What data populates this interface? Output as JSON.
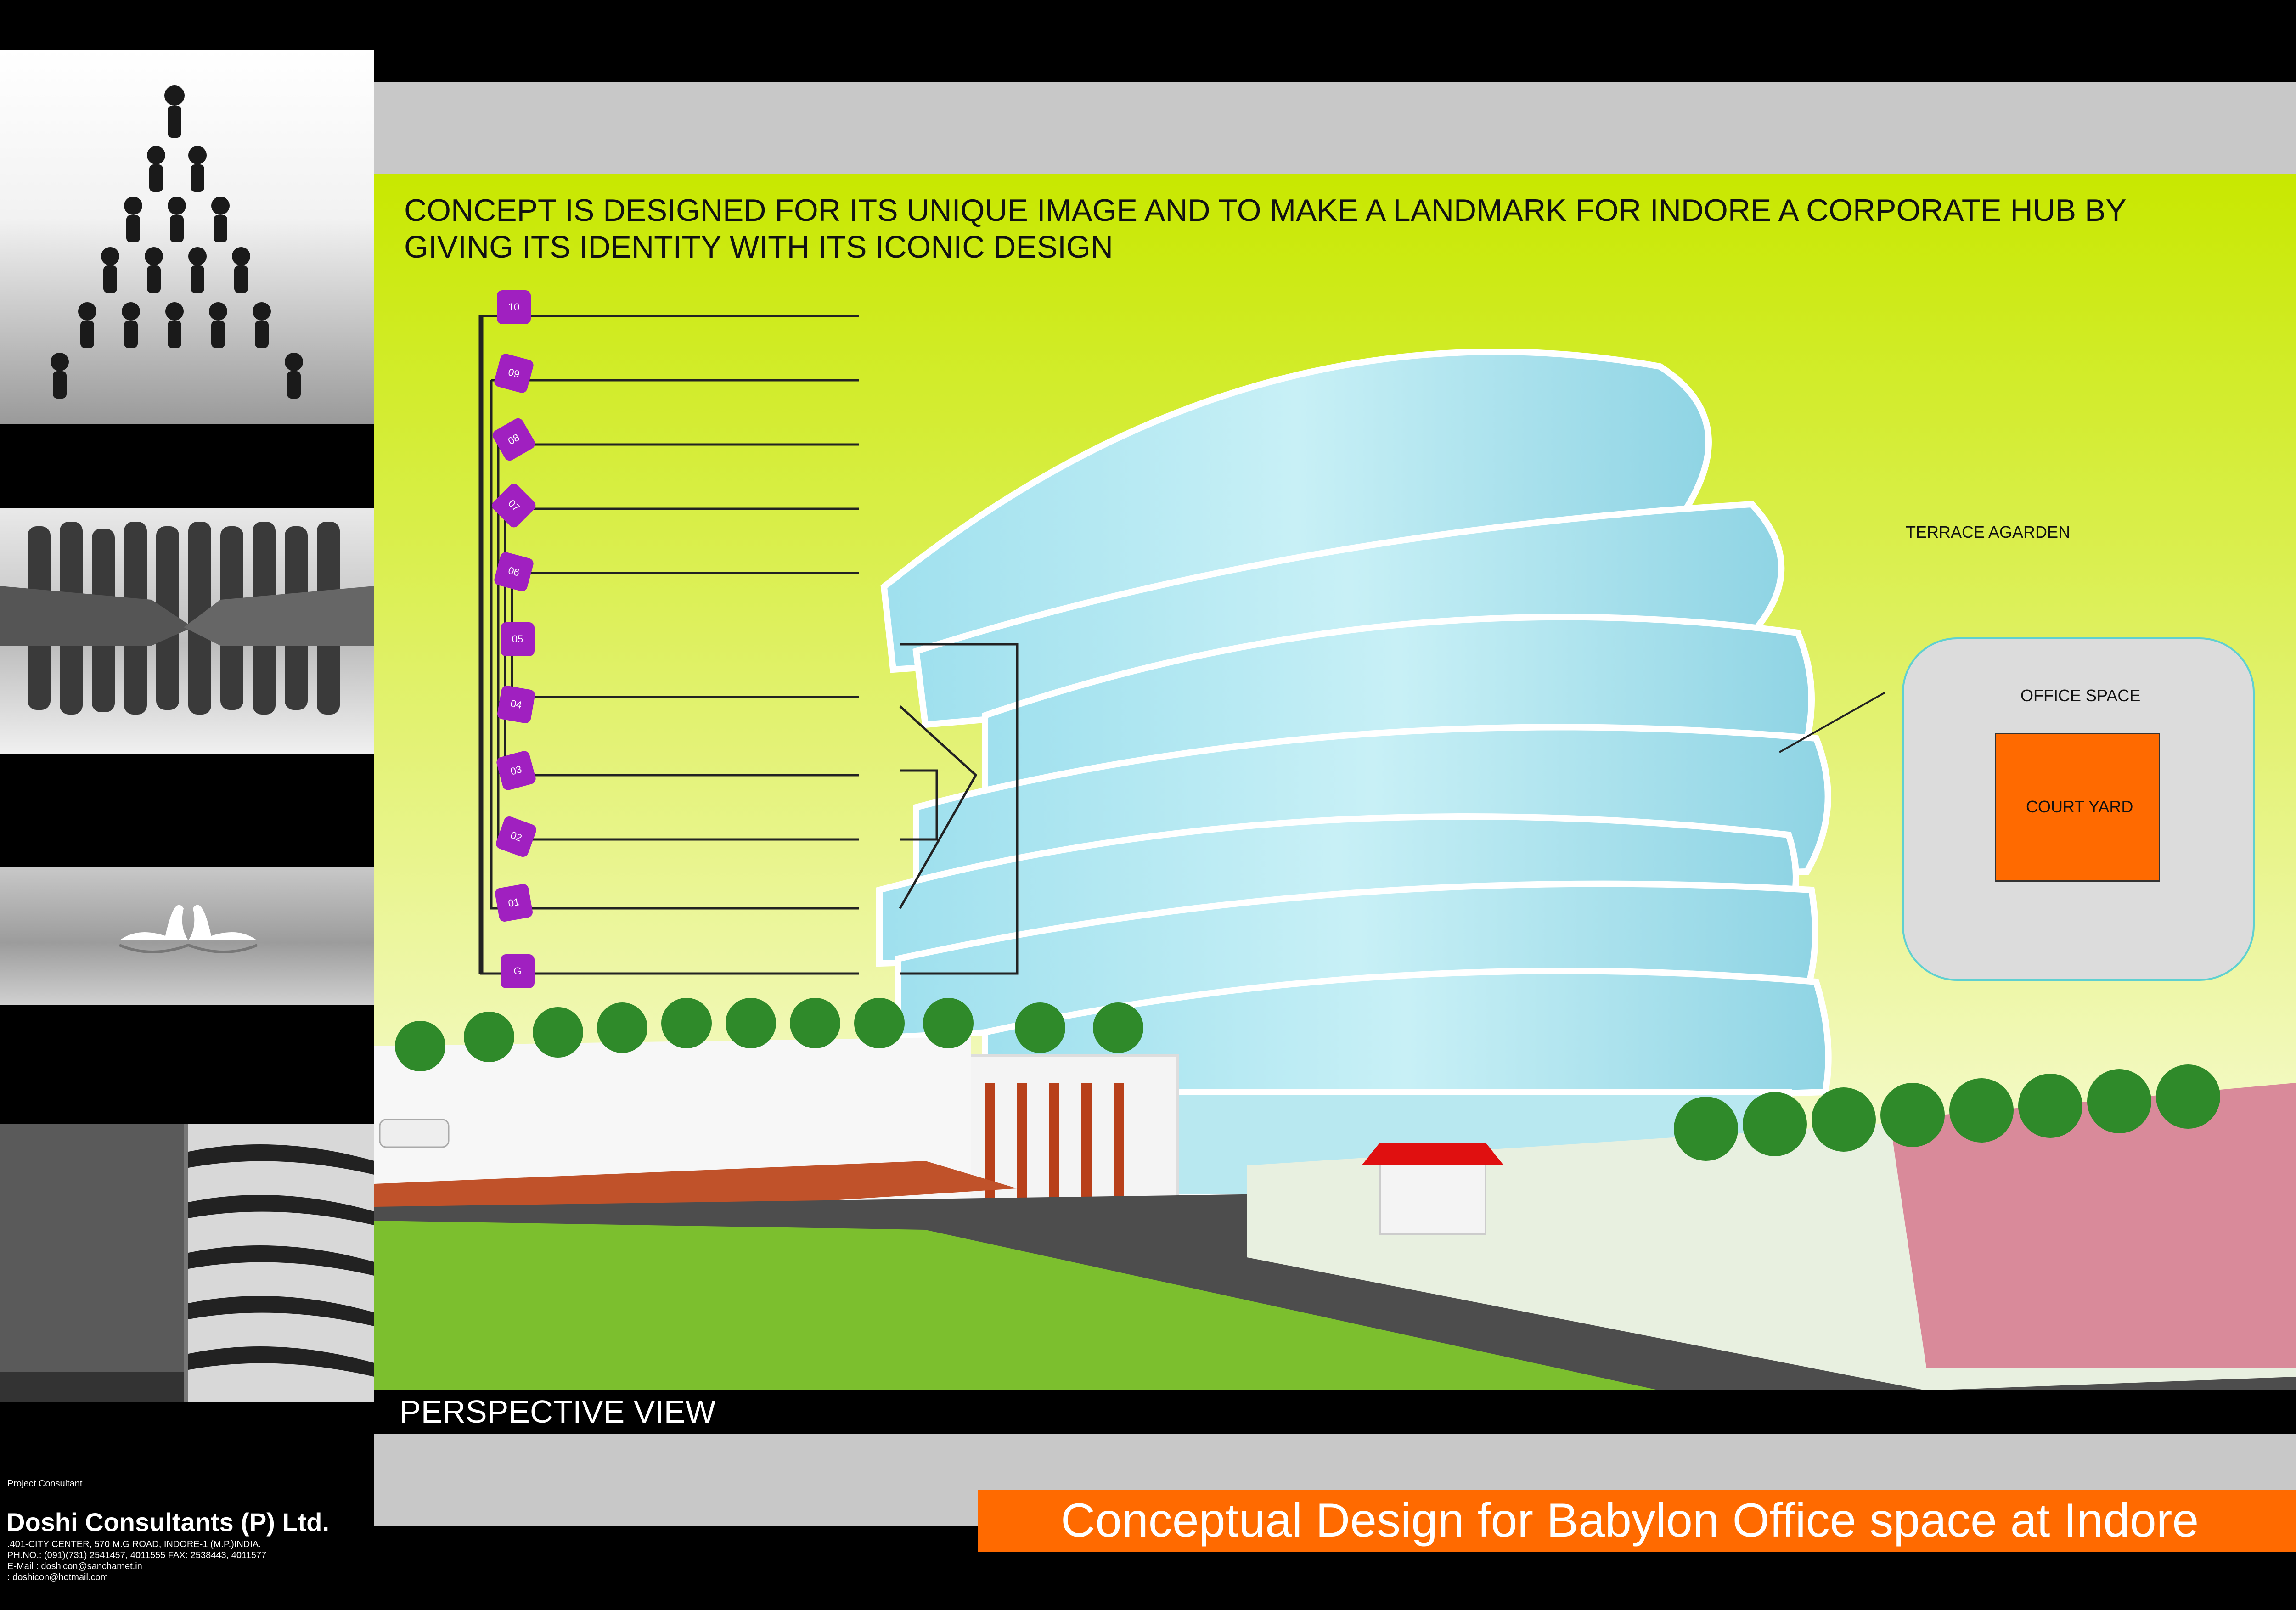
{
  "concept_text": "CONCEPT IS DESIGNED FOR ITS UNIQUE IMAGE AND TO MAKE A LANDMARK FOR INDORE A CORPORATE HUB  BY  GIVING ITS IDENTITY WITH ITS ICONIC DESIGN",
  "floors": [
    "10",
    "09",
    "08",
    "07",
    "06",
    "05",
    "04",
    "03",
    "02",
    "01",
    "G"
  ],
  "terrace_label": "TERRACE AGARDEN",
  "office_space_label": "OFFICE SPACE",
  "court_yard_label": "COURT YARD",
  "view_label": "PERSPECTIVE VIEW",
  "title": "Conceptual Design for Babylon Office space at Indore",
  "consultant": {
    "label": "Project Consultant",
    "name": "Doshi Consultants (P) Ltd.",
    "address_lines": [
      ".401-CITY CENTER, 570 M.G ROAD, INDORE-1 (M.P.)INDIA.",
      "PH.NO.: (091)(731) 2541457, 4011555 FAX: 2538443, 4011577",
      "E-Mail : doshicon@sancharnet.in",
      " : doshicon@hotmail.com"
    ]
  },
  "colors": {
    "accent_orange": "#ff6a00",
    "badge_purple": "#a020c0",
    "sky_green": "#c8e800"
  }
}
